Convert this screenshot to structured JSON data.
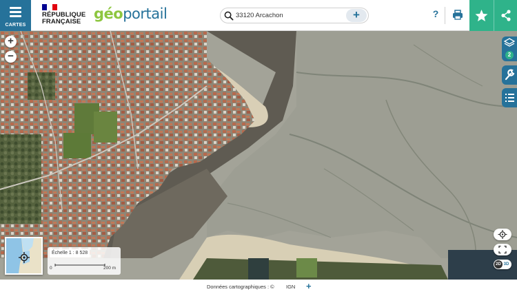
{
  "header": {
    "menu_label": "CARTES",
    "republique_line1": "RÉPUBLIQUE",
    "republique_line2": "FRANÇAISE",
    "brand_geo": "géo",
    "brand_portail": "portail",
    "search": {
      "value": "33120 Arcachon",
      "add_label": "+"
    },
    "help_label": "?"
  },
  "map": {
    "zoom_in": "+",
    "zoom_out": "−",
    "layers_count": "2",
    "scale": {
      "label": "Échelle 1 : 8 528",
      "bar_start": "0",
      "bar_end": "200 m"
    },
    "toggle_2d": "2D",
    "toggle_3d": "3D"
  },
  "footer": {
    "credit": "Données cartographiques : ©",
    "provider": "IGN",
    "more": "+"
  },
  "colors": {
    "brand_blue": "#26729a",
    "brand_green": "#2fb38a",
    "geo_green": "#8dc63f"
  }
}
